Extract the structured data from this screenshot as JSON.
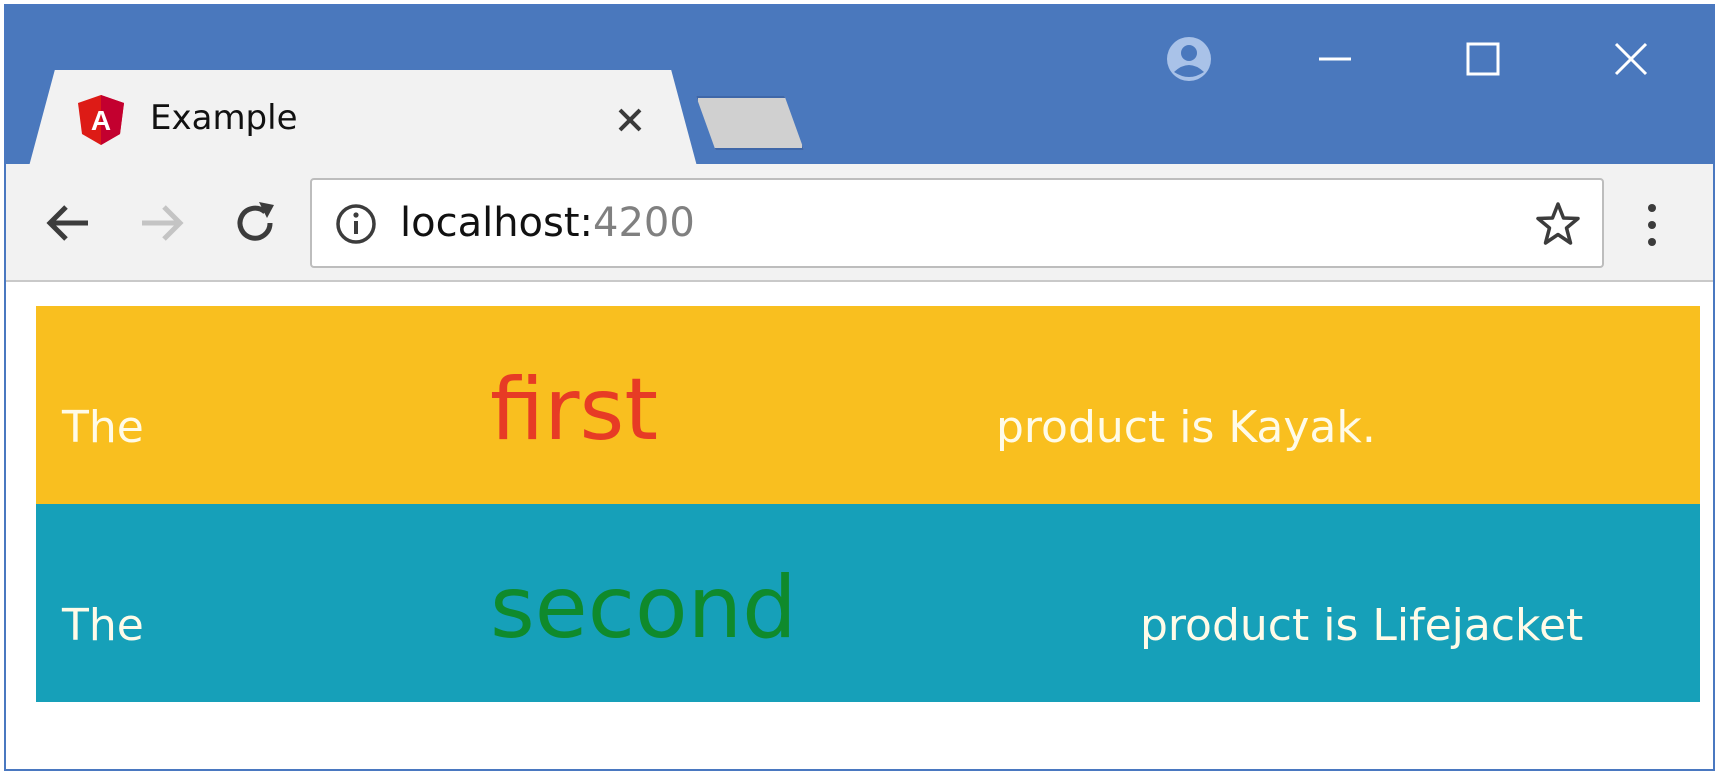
{
  "browser": {
    "tab": {
      "title": "Example",
      "favicon": "angular-icon"
    },
    "address_bar": {
      "host": "localhost:",
      "port": "4200"
    },
    "window_controls": [
      "profile-icon",
      "minimize-icon",
      "maximize-icon",
      "close-icon"
    ],
    "colors": {
      "titlebar": "#4a78bd",
      "toolbar": "#f2f2f2"
    }
  },
  "page": {
    "rows": [
      {
        "lead": "The",
        "ordinal": "first",
        "product": "product is Kayak.",
        "background": "#f9bf1f",
        "ordinal_color": "#e73b25"
      },
      {
        "lead": "The",
        "ordinal": "second",
        "product": "product is Lifejacket",
        "background": "#16a0b9",
        "ordinal_color": "#0f8a2c"
      }
    ]
  }
}
